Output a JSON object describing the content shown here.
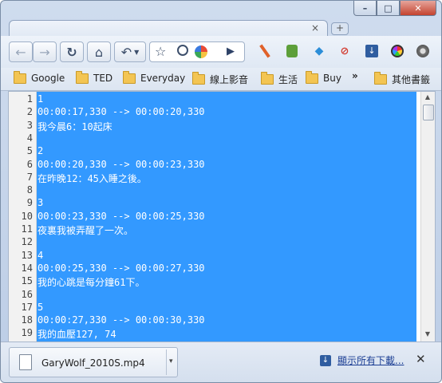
{
  "window": {
    "controls": [
      "–",
      "□",
      "✕"
    ]
  },
  "tabs": {
    "close_glyph": "×",
    "new_tab_glyph": "+"
  },
  "toolbar": {
    "back_glyph": "←",
    "forward_glyph": "→",
    "reload_glyph": "↻",
    "home_glyph": "⌂",
    "undo_glyph": "↶",
    "star_glyph": "☆",
    "play_glyph": "▶"
  },
  "bookmarks": [
    {
      "label": "Google"
    },
    {
      "label": "TED"
    },
    {
      "label": "Everyday"
    },
    {
      "label": "線上影音"
    },
    {
      "label": "生活"
    },
    {
      "label": "Buy"
    }
  ],
  "bookmarks_overflow": "»",
  "bookmarks_other": "其他書籤",
  "editor": {
    "lines": [
      "1",
      "00:00:17,330 --> 00:00:20,330",
      "我今晨6：10起床",
      "",
      "2",
      "00:00:20,330 --> 00:00:23,330",
      "在昨晚12：45入睡之後。",
      "",
      "3",
      "00:00:23,330 --> 00:00:25,330",
      "夜裏我被弄醒了一次。",
      "",
      "4",
      "00:00:25,330 --> 00:00:27,330",
      "我的心跳是每分鐘61下。",
      "",
      "5",
      "00:00:27,330 --> 00:00:30,330",
      "我的血壓127, 74"
    ],
    "line_numbers": [
      "1",
      "2",
      "3",
      "4",
      "5",
      "6",
      "7",
      "8",
      "9",
      "10",
      "11",
      "12",
      "13",
      "14",
      "15",
      "16",
      "17",
      "18",
      "19"
    ]
  },
  "downloads": {
    "file_name": "GaryWolf_2010S.mp4",
    "dropdown_glyph": "▾",
    "show_all": "顯示所有下載...",
    "close_glyph": "✕"
  }
}
